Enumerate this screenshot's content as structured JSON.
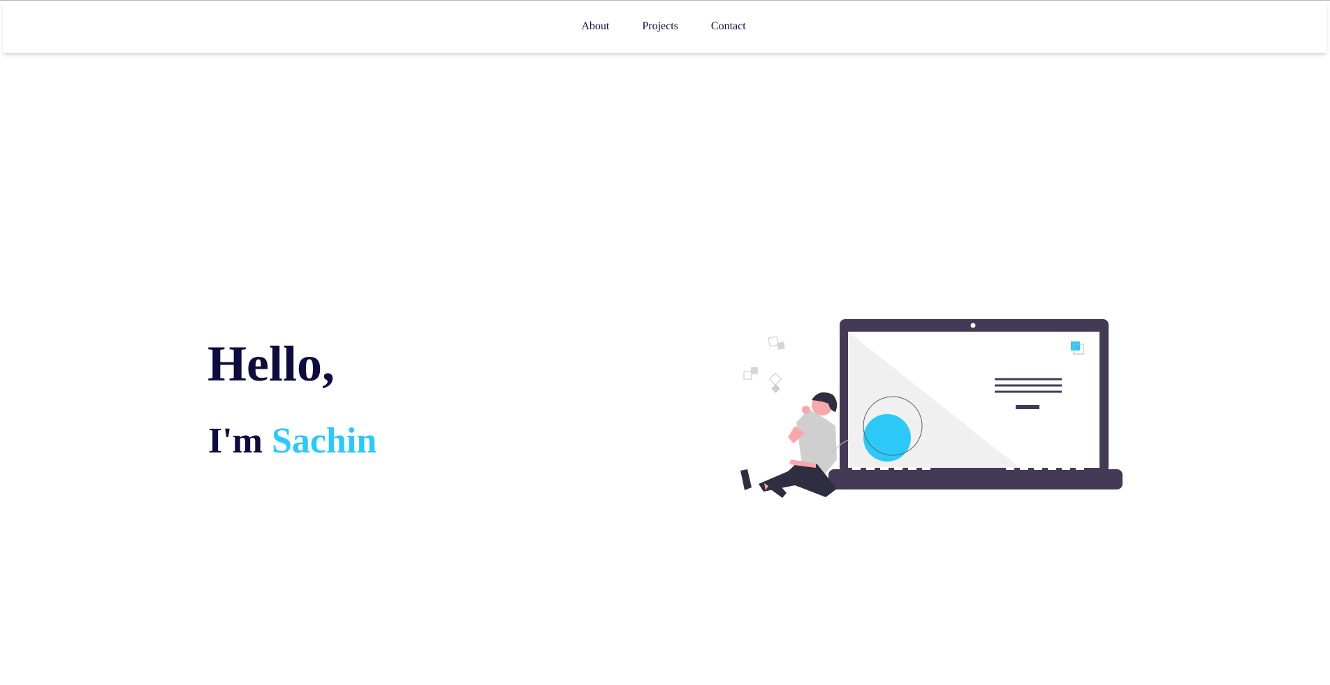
{
  "nav": {
    "links": [
      "About",
      "Projects",
      "Contact"
    ]
  },
  "hero": {
    "greeting": "Hello,",
    "intro_prefix": "I'm",
    "name": "Sachin"
  },
  "colors": {
    "primary_text": "#0e0b3d",
    "accent": "#2cc9f8",
    "laptop": "#453a56",
    "screen": "#f2f2f2"
  },
  "icons": [
    "laptop-illustration",
    "person-illustration"
  ]
}
